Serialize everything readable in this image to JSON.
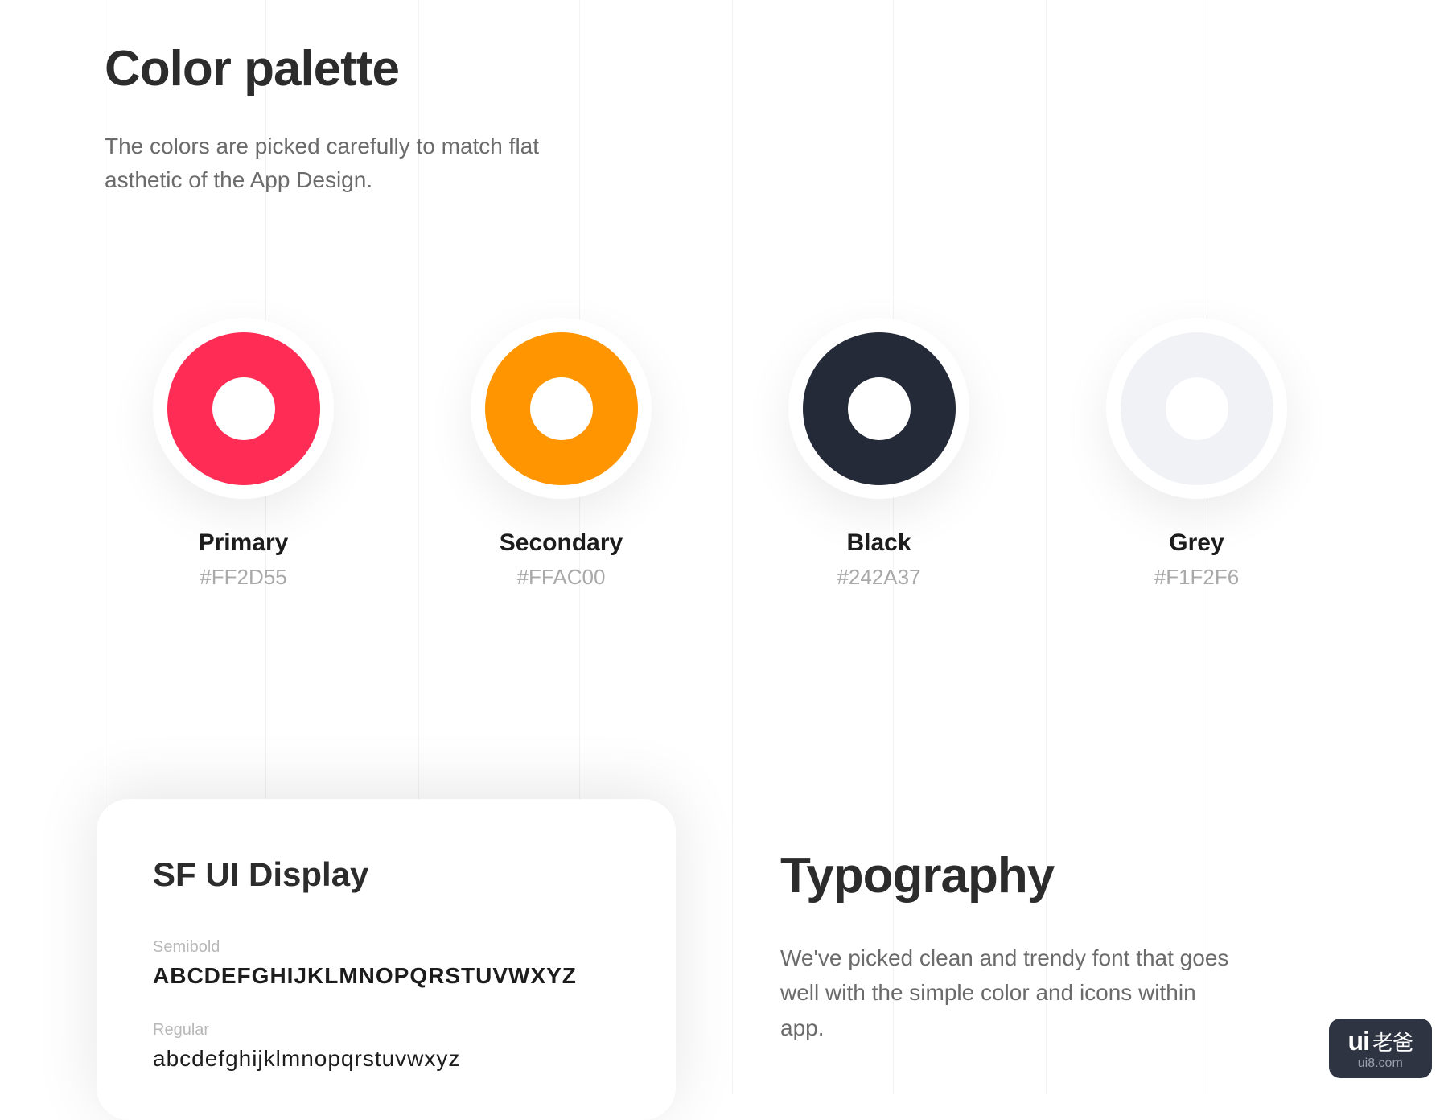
{
  "palette": {
    "title": "Color palette",
    "desc": "The colors are picked carefully to match flat asthetic of the App Design.",
    "swatches": [
      {
        "name": "Primary",
        "hex": "#FF2D55",
        "color": "#FF2D55"
      },
      {
        "name": "Secondary",
        "hex": "#FFAC00",
        "color": "#FF9500"
      },
      {
        "name": "Black",
        "hex": "#242A37",
        "color": "#242A37"
      },
      {
        "name": "Grey",
        "hex": "#F1F2F6",
        "color": "#F1F2F6"
      }
    ]
  },
  "typography": {
    "title": "Typography",
    "desc": "We've picked clean and trendy font that goes well with the simple color and icons within app.",
    "card": {
      "title": "SF UI Display",
      "weights": [
        {
          "label": "Semibold",
          "sample": "ABCDEFGHIJKLMNOPQRSTUVWXYZ"
        },
        {
          "label": "Regular",
          "sample": "abcdefghijklmnopqrstuvwxyz"
        }
      ]
    }
  },
  "badge": {
    "brand": "ui",
    "cn": "老爸",
    "url": "ui8.com"
  }
}
